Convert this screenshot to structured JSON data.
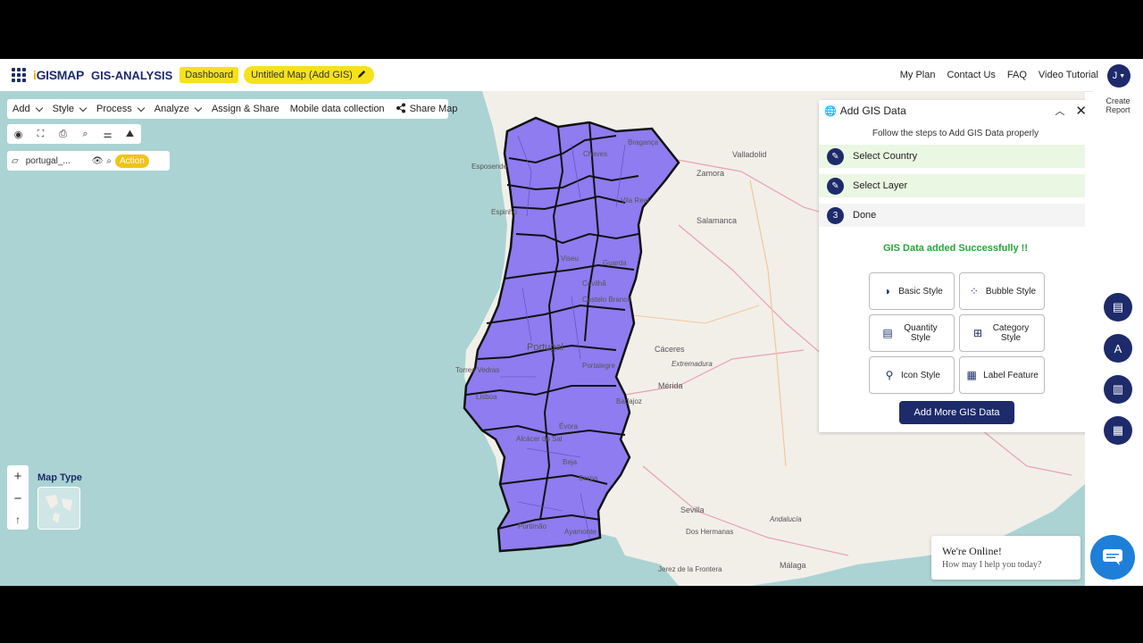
{
  "header": {
    "logo_prefix": "i",
    "logo_text": "GISMAP",
    "app_name": "GIS-ANALYSIS",
    "dashboard_label": "Dashboard",
    "map_title": "Untitled Map (Add GIS)",
    "links": [
      "My Plan",
      "Contact Us",
      "FAQ",
      "Video Tutorial"
    ],
    "avatar_initial": "J"
  },
  "menubar": {
    "items": [
      "Add",
      "Style",
      "Process",
      "Analyze",
      "Assign & Share",
      "Mobile data collection",
      "Share Map"
    ]
  },
  "toolbar": {
    "icons": [
      "locate-icon",
      "fullscreen-icon",
      "print-icon",
      "search-icon",
      "measure-icon",
      "layers-icon"
    ]
  },
  "layer": {
    "name": "portugal_...",
    "action_label": "Action"
  },
  "map_controls": {
    "zoom_in": "+",
    "zoom_out": "−",
    "north": "↑",
    "map_type_label": "Map Type"
  },
  "map_labels": [
    "Esposende",
    "Espinho",
    "Chaves",
    "Bragança",
    "Vila Real",
    "Viseu",
    "Guarda",
    "Covilhã",
    "Castelo Branco",
    "Portugal",
    "Portalegre",
    "Évora",
    "Beja",
    "Serpa",
    "Alcácer do Sal",
    "Portimão",
    "Ayamonte",
    "Lisboa",
    "Torres Vedras",
    "Valladolid",
    "Zamora",
    "Salamanca",
    "Cáceres",
    "Extremadura",
    "Mérida",
    "Badajoz",
    "Sevilla",
    "Andalucía",
    "Dos Hermanas",
    "Málaga",
    "Jerez de la Frontera"
  ],
  "panel": {
    "title": "Add GIS Data",
    "subtitle": "Follow the steps to Add GIS Data properly",
    "steps": [
      {
        "label": "Select Country",
        "status": "done"
      },
      {
        "label": "Select Layer",
        "status": "done"
      },
      {
        "label": "Done",
        "number": "3",
        "status": "current"
      }
    ],
    "success_message": "GIS Data added Successfully !!",
    "style_buttons": [
      "Basic Style",
      "Bubble Style",
      "Quantity Style",
      "Category Style",
      "Icon Style",
      "Label Feature"
    ],
    "add_more_label": "Add More GIS Data"
  },
  "right_sidebar": {
    "create_report_label": "Create Report"
  },
  "chat": {
    "line1": "We're Online!",
    "line2": "How may I help you today?"
  },
  "colors": {
    "primary": "#1d2b6b",
    "accent_yellow": "#f6e11d",
    "region_fill": "#8e7cf0",
    "sea": "#abd3d3",
    "success": "#22a836"
  }
}
